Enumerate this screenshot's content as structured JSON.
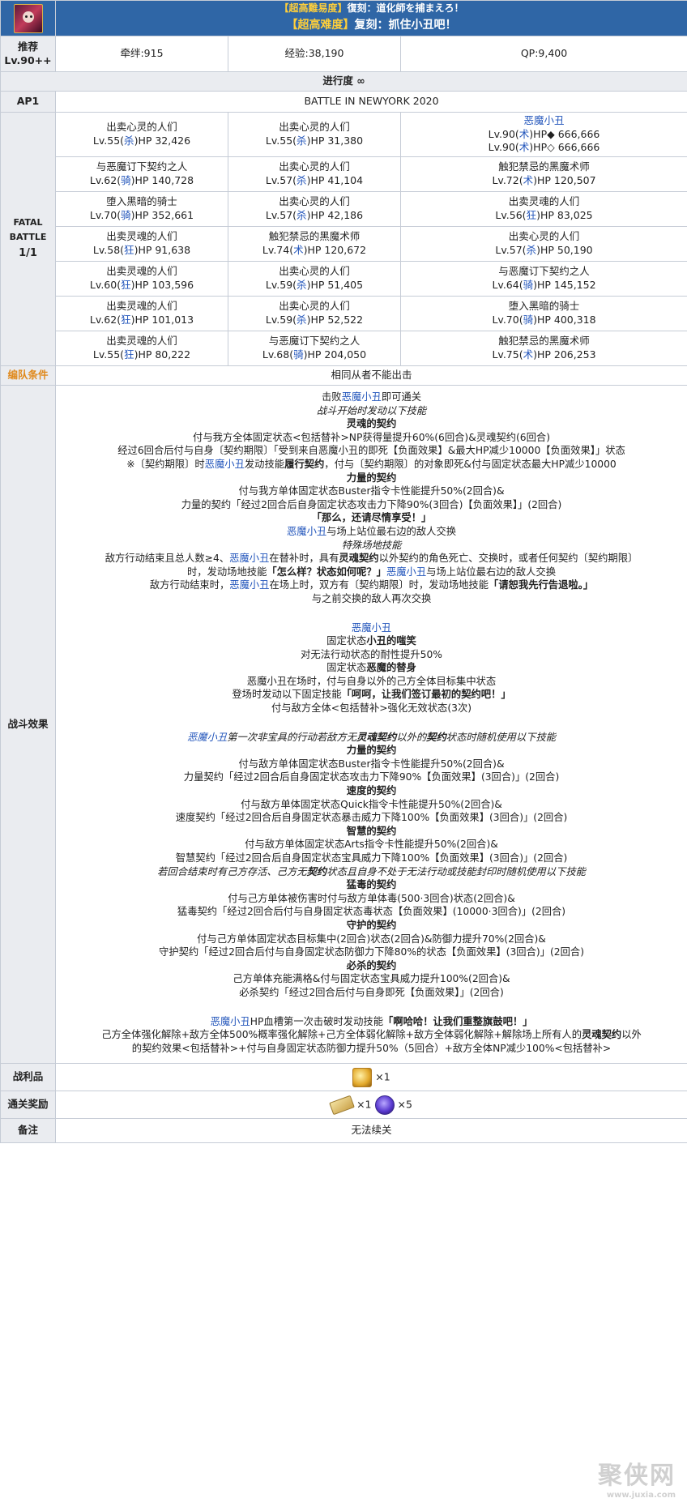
{
  "header": {
    "sub_tag": "【超高難易度】",
    "sub_title": "復刻：道化師を捕まえろ！",
    "main_tag": "【超高难度】",
    "main_title": "复刻：抓住小丑吧！"
  },
  "recommend": {
    "label_line1": "推荐",
    "label_line2": "Lv.90++",
    "bond": "牵绊:915",
    "exp": "经验:38,190",
    "qp": "QP:9,400"
  },
  "progress": "进行度 ∞",
  "ap": {
    "label": "AP1",
    "battle_name": "BATTLE IN NEWYORK 2020"
  },
  "fatal": {
    "line1": "FATAL",
    "line2": "BATTLE",
    "line3": "1/1"
  },
  "enemies": [
    [
      {
        "name": "出卖心灵的人们",
        "lv": "Lv.55(",
        "cls": "杀",
        "hp": ")HP 32,426",
        "blue": false
      },
      {
        "name": "出卖心灵的人们",
        "lv": "Lv.55(",
        "cls": "杀",
        "hp": ")HP 31,380",
        "blue": false
      },
      {
        "name": "恶魔小丑",
        "lv": "Lv.90(",
        "cls": "术",
        "hp": ")HP◆ 666,666",
        "lv2": "Lv.90(",
        "cls2": "术",
        "hp2": ")HP◇ 666,666",
        "blue": true
      }
    ],
    [
      {
        "name": "与恶魔订下契约之人",
        "lv": "Lv.62(",
        "cls": "骑",
        "hp": ")HP 140,728",
        "blue": false
      },
      {
        "name": "出卖心灵的人们",
        "lv": "Lv.57(",
        "cls": "杀",
        "hp": ")HP 41,104",
        "blue": false
      },
      {
        "name": "触犯禁忌的黑魔术师",
        "lv": "Lv.72(",
        "cls": "术",
        "hp": ")HP 120,507",
        "blue": false
      }
    ],
    [
      {
        "name": "堕入黑暗的骑士",
        "lv": "Lv.70(",
        "cls": "骑",
        "hp": ")HP 352,661",
        "blue": false
      },
      {
        "name": "出卖心灵的人们",
        "lv": "Lv.57(",
        "cls": "杀",
        "hp": ")HP 42,186",
        "blue": false
      },
      {
        "name": "出卖灵魂的人们",
        "lv": "Lv.56(",
        "cls": "狂",
        "hp": ")HP 83,025",
        "blue": false
      }
    ],
    [
      {
        "name": "出卖灵魂的人们",
        "lv": "Lv.58(",
        "cls": "狂",
        "hp": ")HP 91,638",
        "blue": false
      },
      {
        "name": "触犯禁忌的黑魔术师",
        "lv": "Lv.74(",
        "cls": "术",
        "hp": ")HP 120,672",
        "blue": false
      },
      {
        "name": "出卖心灵的人们",
        "lv": "Lv.57(",
        "cls": "杀",
        "hp": ")HP 50,190",
        "blue": false
      }
    ],
    [
      {
        "name": "出卖灵魂的人们",
        "lv": "Lv.60(",
        "cls": "狂",
        "hp": ")HP 103,596",
        "blue": false
      },
      {
        "name": "出卖心灵的人们",
        "lv": "Lv.59(",
        "cls": "杀",
        "hp": ")HP 51,405",
        "blue": false
      },
      {
        "name": "与恶魔订下契约之人",
        "lv": "Lv.64(",
        "cls": "骑",
        "hp": ")HP 145,152",
        "blue": false
      }
    ],
    [
      {
        "name": "出卖灵魂的人们",
        "lv": "Lv.62(",
        "cls": "狂",
        "hp": ")HP 101,013",
        "blue": false
      },
      {
        "name": "出卖心灵的人们",
        "lv": "Lv.59(",
        "cls": "杀",
        "hp": ")HP 52,522",
        "blue": false
      },
      {
        "name": "堕入黑暗的骑士",
        "lv": "Lv.70(",
        "cls": "骑",
        "hp": ")HP 400,318",
        "blue": false
      }
    ],
    [
      {
        "name": "出卖灵魂的人们",
        "lv": "Lv.55(",
        "cls": "狂",
        "hp": ")HP 80,222",
        "blue": false
      },
      {
        "name": "与恶魔订下契约之人",
        "lv": "Lv.68(",
        "cls": "骑",
        "hp": ")HP 204,050",
        "blue": false
      },
      {
        "name": "触犯禁忌的黑魔术师",
        "lv": "Lv.75(",
        "cls": "术",
        "hp": ")HP 206,253",
        "blue": false
      }
    ]
  ],
  "formation": {
    "label": "编队条件",
    "text": "相同从者不能出击"
  },
  "effects_label": "战斗效果",
  "effects": [
    [
      {
        "t": "击败"
      },
      {
        "t": "恶魔小丑",
        "c": "blue"
      },
      {
        "t": "即可通关"
      }
    ],
    [
      {
        "t": "战斗开始时发动以下技能",
        "c": "it"
      }
    ],
    [
      {
        "t": "灵魂的契约",
        "c": "b"
      }
    ],
    [
      {
        "t": "付与我方全体固定状态<包括替补>NP获得量提升60%(6回合)&灵魂契约(6回合)"
      }
    ],
    [
      {
        "t": "经过6回合后付与自身〔契约期限〕「受到来自恶魔小丑的即死【负面效果】&最大HP减少10000【负面效果】」状态"
      }
    ],
    [
      {
        "t": "※〔契约期限〕时"
      },
      {
        "t": "恶魔小丑",
        "c": "blue"
      },
      {
        "t": "发动技能"
      },
      {
        "t": "履行契约",
        "c": "b"
      },
      {
        "t": "，付与〔契约期限〕的对象即死&付与固定状态最大HP减少10000"
      }
    ],
    [
      {
        "t": "力量的契约",
        "c": "b"
      }
    ],
    [
      {
        "t": "付与我方单体固定状态Buster指令卡性能提升50%(2回合)&"
      }
    ],
    [
      {
        "t": "力量的契约「经过2回合后自身固定状态攻击力下降90%(3回合)【负面效果】」(2回合)"
      }
    ],
    [
      {
        "t": "「那么，还请尽情享受！」",
        "c": "b"
      }
    ],
    [
      {
        "t": "恶魔小丑",
        "c": "blue"
      },
      {
        "t": "与场上站位最右边的敌人交换"
      }
    ],
    [
      {
        "t": "特殊场地技能",
        "c": "it"
      }
    ],
    [
      {
        "t": "敌方行动结束且总人数≥4、"
      },
      {
        "t": "恶魔小丑",
        "c": "blue"
      },
      {
        "t": "在替补时，具有"
      },
      {
        "t": "灵魂契约",
        "c": "b"
      },
      {
        "t": "以外契约的角色死亡、交换时，或者任何契约〔契约期限〕"
      }
    ],
    [
      {
        "t": "时，发动场地技能"
      },
      {
        "t": "「怎么样？状态如何呢？」",
        "c": "b"
      },
      {
        "t": "恶魔小丑",
        "c": "blue"
      },
      {
        "t": "与场上站位最右边的敌人交换"
      }
    ],
    [
      {
        "t": "敌方行动结束时，"
      },
      {
        "t": "恶魔小丑",
        "c": "blue"
      },
      {
        "t": "在场上时，双方有〔契约期限〕时，发动场地技能"
      },
      {
        "t": "「请恕我先行告退啦。」",
        "c": "b"
      }
    ],
    [
      {
        "t": "与之前交换的敌人再次交换"
      }
    ],
    [],
    [
      {
        "t": "恶魔小丑",
        "c": "blue"
      }
    ],
    [
      {
        "t": "固定状态"
      },
      {
        "t": "小丑的嗤笑",
        "c": "b"
      }
    ],
    [
      {
        "t": "对无法行动状态的耐性提升50%"
      }
    ],
    [
      {
        "t": "固定状态"
      },
      {
        "t": "恶魔的替身",
        "c": "b"
      }
    ],
    [
      {
        "t": "恶魔小丑在场时，付与自身以外的己方全体目标集中状态"
      }
    ],
    [
      {
        "t": "登场时发动以下固定技能"
      },
      {
        "t": "「呵呵，让我们签订最初的契约吧！」",
        "c": "b"
      }
    ],
    [
      {
        "t": "付与敌方全体<包括替补>强化无效状态(3次)"
      }
    ],
    [],
    [
      {
        "t": "恶魔小丑",
        "c": "blue it"
      },
      {
        "t": "第一次非宝具的行动若敌方无",
        "c": "it"
      },
      {
        "t": "灵魂契约",
        "c": "it b"
      },
      {
        "t": "以外的",
        "c": "it"
      },
      {
        "t": "契约",
        "c": "it b"
      },
      {
        "t": "状态时随机使用以下技能",
        "c": "it"
      }
    ],
    [
      {
        "t": "力量的契约",
        "c": "b"
      }
    ],
    [
      {
        "t": "付与敌方单体固定状态Buster指令卡性能提升50%(2回合)&"
      }
    ],
    [
      {
        "t": "力量契约「经过2回合后自身固定状态攻击力下降90%【负面效果】(3回合)」(2回合)"
      }
    ],
    [
      {
        "t": "速度的契约",
        "c": "b"
      }
    ],
    [
      {
        "t": "付与敌方单体固定状态Quick指令卡性能提升50%(2回合)&"
      }
    ],
    [
      {
        "t": "速度契约「经过2回合后自身固定状态暴击威力下降100%【负面效果】(3回合)」(2回合)"
      }
    ],
    [
      {
        "t": "智慧的契约",
        "c": "b"
      }
    ],
    [
      {
        "t": "付与敌方单体固定状态Arts指令卡性能提升50%(2回合)&"
      }
    ],
    [
      {
        "t": "智慧契约「经过2回合后自身固定状态宝具威力下降100%【负面效果】(3回合)」(2回合)"
      }
    ],
    [
      {
        "t": "若回合结束时有己方存活、己方无",
        "c": "it"
      },
      {
        "t": "契约",
        "c": "it b"
      },
      {
        "t": "状态且自身不处于无法行动或技能封印时随机使用以下技能",
        "c": "it"
      }
    ],
    [
      {
        "t": "猛毒的契约",
        "c": "b"
      }
    ],
    [
      {
        "t": "付与己方单体被伤害时付与敌方单体毒(500·3回合)状态(2回合)&"
      }
    ],
    [
      {
        "t": "猛毒契约「经过2回合后付与自身固定状态毒状态【负面效果】(10000·3回合)」(2回合)"
      }
    ],
    [
      {
        "t": "守护的契约",
        "c": "b"
      }
    ],
    [
      {
        "t": "付与己方单体固定状态目标集中(2回合)状态(2回合)&防御力提升70%(2回合)&"
      }
    ],
    [
      {
        "t": "守护契约「经过2回合后付与自身固定状态防御力下降80%的状态【负面效果】(3回合)」(2回合)"
      }
    ],
    [
      {
        "t": "必杀的契约",
        "c": "b"
      }
    ],
    [
      {
        "t": "己方单体充能满格&付与固定状态宝具威力提升100%(2回合)&"
      }
    ],
    [
      {
        "t": "必杀契约「经过2回合后付与自身即死【负面效果】」(2回合)"
      }
    ],
    [],
    [
      {
        "t": "恶魔小丑",
        "c": "blue"
      },
      {
        "t": "HP血槽第一次击破时发动技能"
      },
      {
        "t": "「啊哈哈！让我们重整旗鼓吧！」",
        "c": "b"
      }
    ],
    [
      {
        "t": "己方全体强化解除+敌方全体500%概率强化解除+己方全体弱化解除+敌方全体弱化解除+解除场上所有人的"
      },
      {
        "t": "灵魂契约",
        "c": "b"
      },
      {
        "t": "以外"
      }
    ],
    [
      {
        "t": "的契约效果<包括替补>+付与自身固定状态防御力提升50%（5回合）+敌方全体NP减少100%<包括替补>"
      }
    ]
  ],
  "loot": {
    "label": "战利品",
    "count": "×1",
    "icon": "gold-material-icon"
  },
  "clear_reward": {
    "label": "通关奖励",
    "count1": "×1",
    "count2": "×5",
    "icon1": "ticket-icon",
    "icon2": "purple-gem-icon"
  },
  "notes": {
    "label": "备注",
    "text": "无法续关"
  },
  "watermark": {
    "text": "聚侠网",
    "sub": "www.juxia.com"
  }
}
